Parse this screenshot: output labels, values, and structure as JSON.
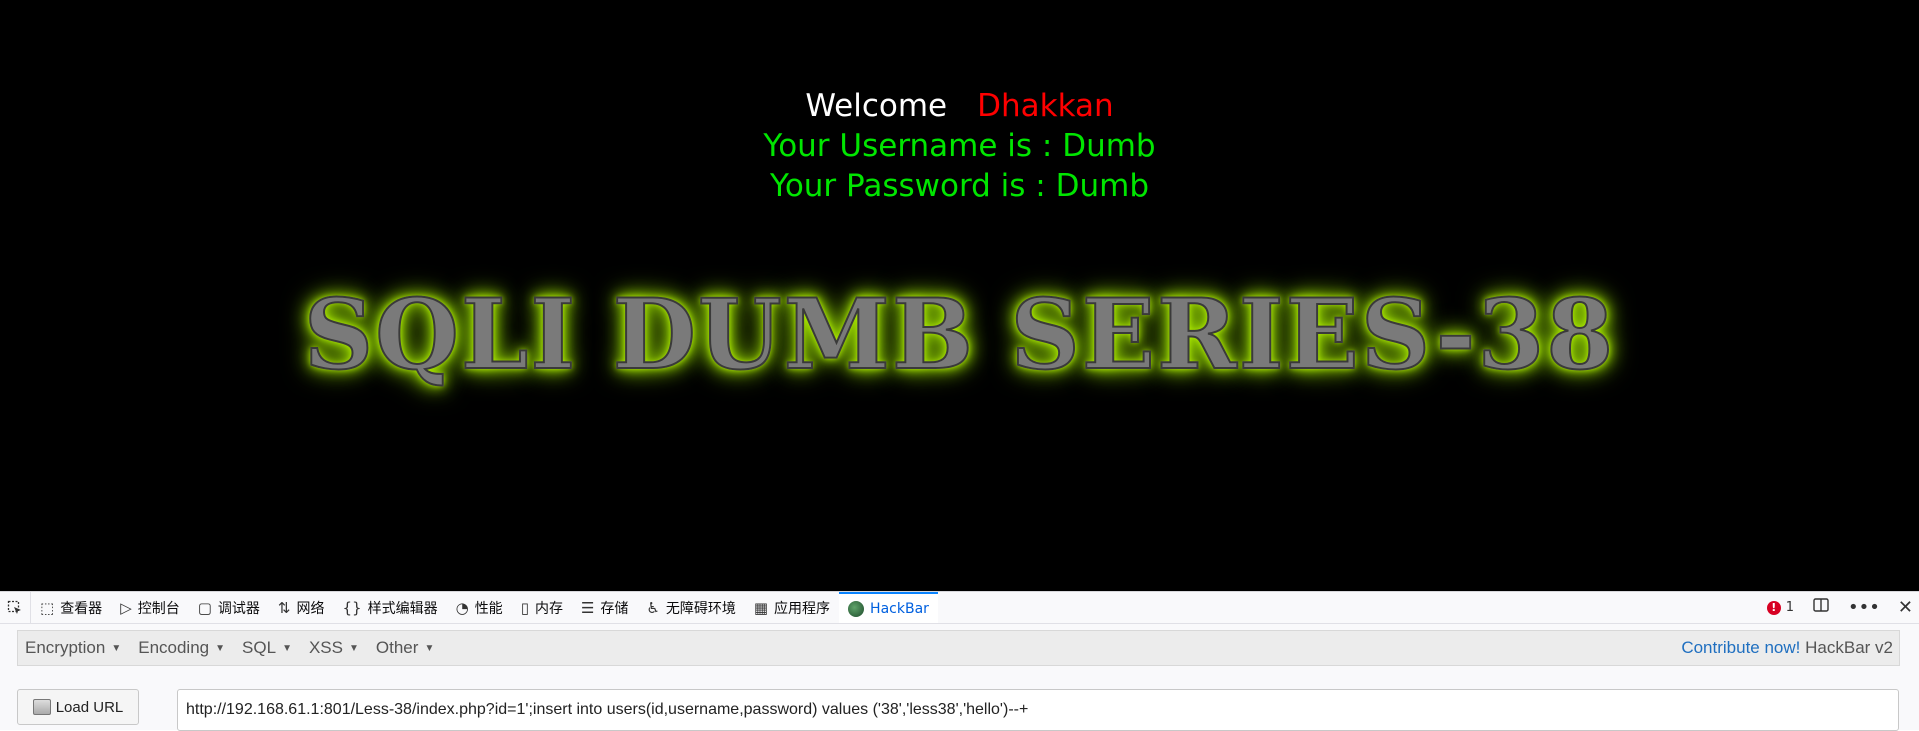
{
  "page": {
    "welcome_label": "Welcome",
    "welcome_name": "Dhakkan",
    "username_line": "Your Username is : Dumb",
    "password_line": "Your Password is : Dumb",
    "banner_title": "SQLI DUMB SERIES-38"
  },
  "devtools": {
    "tabs": [
      {
        "label": "查看器",
        "icon": "inspector-icon"
      },
      {
        "label": "控制台",
        "icon": "console-icon"
      },
      {
        "label": "调试器",
        "icon": "debugger-icon"
      },
      {
        "label": "网络",
        "icon": "network-icon"
      },
      {
        "label": "样式编辑器",
        "icon": "style-editor-icon"
      },
      {
        "label": "性能",
        "icon": "performance-icon"
      },
      {
        "label": "内存",
        "icon": "memory-icon"
      },
      {
        "label": "存储",
        "icon": "storage-icon"
      },
      {
        "label": "无障碍环境",
        "icon": "accessibility-icon"
      },
      {
        "label": "应用程序",
        "icon": "application-icon"
      },
      {
        "label": "HackBar",
        "icon": "hackbar-logo-icon"
      }
    ],
    "active_tab": "HackBar",
    "error_count": "1"
  },
  "hackbar": {
    "menus": [
      "Encryption",
      "Encoding",
      "SQL",
      "XSS",
      "Other"
    ],
    "contribute": "Contribute now!",
    "version": "HackBar v2",
    "load_url": "Load URL",
    "url_value": "http://192.168.61.1:801/Less-38/index.php?id=1';insert into users(id,username,password) values ('38','less38','hello')--+"
  },
  "colors": {
    "page_bg": "#000000",
    "welcome_text": "#ffffff",
    "name_text": "#ff0000",
    "info_text": "#00e600",
    "banner_glow": "#b7f000",
    "active_tab": "#0060df",
    "contribute_link": "#1f6fc0"
  }
}
